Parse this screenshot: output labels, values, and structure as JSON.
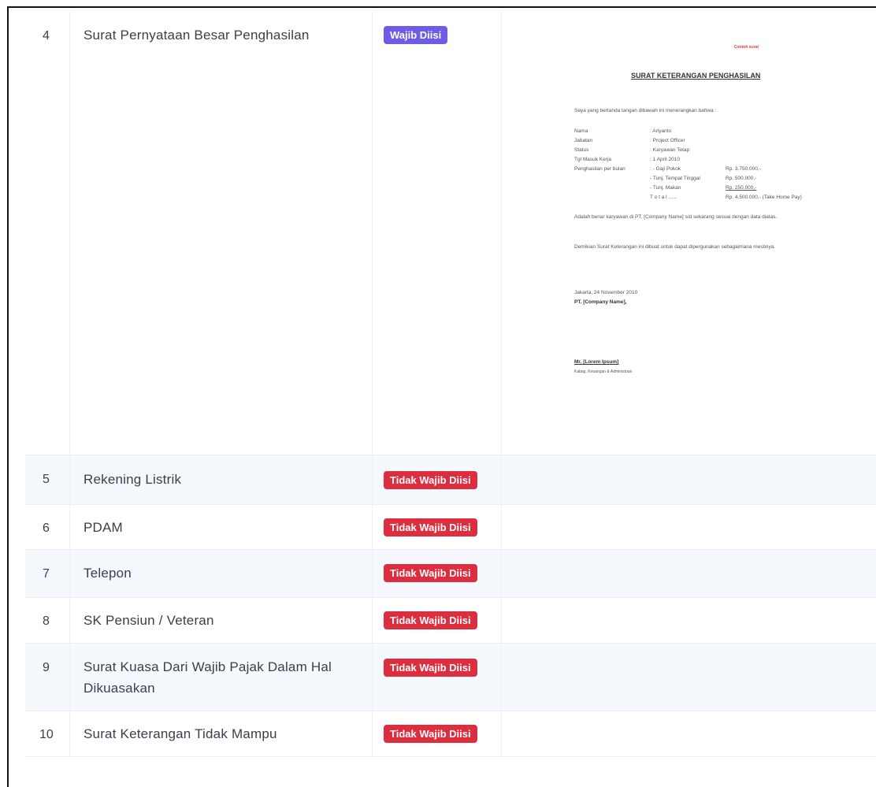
{
  "rows": [
    {
      "no": "4",
      "name": "Surat Pernyataan Besar Penghasilan",
      "badge": "Wajib Diisi"
    },
    {
      "no": "5",
      "name": "Rekening Listrik",
      "badge": "Tidak Wajib Diisi"
    },
    {
      "no": "6",
      "name": "PDAM",
      "badge": "Tidak Wajib Diisi"
    },
    {
      "no": "7",
      "name": "Telepon",
      "badge": "Tidak Wajib Diisi"
    },
    {
      "no": "8",
      "name": "SK Pensiun / Veteran",
      "badge": "Tidak Wajib Diisi"
    },
    {
      "no": "9",
      "name": "Surat Kuasa Dari Wajib Pajak Dalam Hal Dikuasakan",
      "badge": "Tidak Wajib Diisi"
    },
    {
      "no": "10",
      "name": "Surat Keterangan Tidak Mampu",
      "badge": "Tidak Wajib Diisi"
    }
  ],
  "example_doc": {
    "brand": "Contoh surat",
    "title": "SURAT KETERANGAN PENGHASILAN",
    "intro": "Saya yang bertanda tangan dibawah ini menerangkan bahwa :",
    "fields": [
      {
        "k": "Nama",
        "v": ": Ariyanto"
      },
      {
        "k": "Jabatan",
        "v": ": Project Officer"
      },
      {
        "k": "Status",
        "v": ": Karyawan Tetap"
      },
      {
        "k": "Tgl Masuk Kerja",
        "v": ": 1 April 2010"
      }
    ],
    "salary_label": "Penghasilan per bulan",
    "salary": [
      {
        "a": ": - Gaji Pokok",
        "b": "Rp. 3.750.000,-"
      },
      {
        "a": "  - Tunj. Tempat Tinggal",
        "b": "Rp.    500.000,-"
      },
      {
        "a": "  - Tunj. Makan",
        "b": "Rp.    250.000,-"
      },
      {
        "a": "      T o t a l ......",
        "b": "Rp. 4.500.000,- (Take Home Pay)"
      }
    ],
    "para1": "Adalah benar karyawan di PT. [Company Name] s/d sekarang sesuai dengan data diatas.",
    "para2": "Demikian Surat Keterangan ini dibuat untuk dapat dipergunakan sebagaimana mestinya.",
    "place_date": "Jakarta, 24 November 2010",
    "company": "PT. [Company Name],",
    "signer": "Mr. [Lorem Ipsum]",
    "signer_title": "Kabag. Keuangan & Administrasi"
  },
  "colors": {
    "required": "#6c5ce7",
    "optional": "#dc2e3f",
    "row_shade": "#f5f8fd"
  }
}
